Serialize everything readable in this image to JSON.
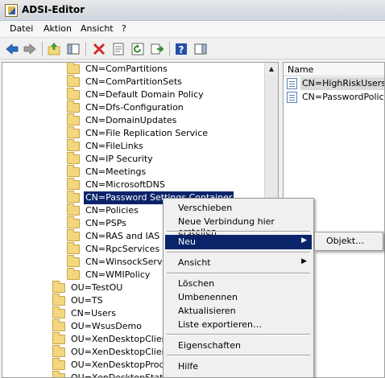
{
  "window": {
    "title": "ADSI-Editor"
  },
  "menu": [
    "Datei",
    "Aktion",
    "Ansicht",
    "?"
  ],
  "toolbar": {
    "icons": [
      "back-arrow-icon",
      "forward-arrow-icon",
      "up-folder-icon",
      "show-hide-tree-icon",
      "delete-icon",
      "properties-icon",
      "refresh-icon",
      "export-list-icon",
      "help-icon",
      "action-pane-icon"
    ],
    "colors": {
      "back": "#2b6cc4",
      "delete": "#d22b2b",
      "help": "#2450a8"
    }
  },
  "tree": {
    "items": [
      "CN=ComPartitions",
      "CN=ComPartitionSets",
      "CN=Default Domain Policy",
      "CN=Dfs-Configuration",
      "CN=DomainUpdates",
      "CN=File Replication Service",
      "CN=FileLinks",
      "CN=IP Security",
      "CN=Meetings",
      "CN=MicrosoftDNS",
      "CN=Password Settings Container",
      "CN=Policies",
      "CN=PSPs",
      "CN=RAS and IAS Se",
      "CN=RpcServices",
      "CN=WinsockService",
      "CN=WMIPolicy",
      "OU=TestOU",
      "OU=TS",
      "CN=Users",
      "OU=WsusDemo",
      "OU=XenDesktopClients",
      "OU=XenDesktopClientsN",
      "OU=XenDesktopProd",
      "OU=XenDesktopStatic"
    ],
    "selected_index": 10
  },
  "list": {
    "header": "Name",
    "items": [
      "CN=HighRiskUsers",
      "CN=PasswordPolicy"
    ]
  },
  "context_menu": {
    "items": [
      "Verschieben",
      "Neue Verbindung hier erstellen",
      "Neu",
      "Ansicht",
      "Löschen",
      "Umbenennen",
      "Aktualisieren",
      "Liste exportieren…",
      "Eigenschaften",
      "Hilfe"
    ],
    "active": "Neu"
  },
  "submenu": {
    "items": [
      "Objekt…"
    ]
  }
}
